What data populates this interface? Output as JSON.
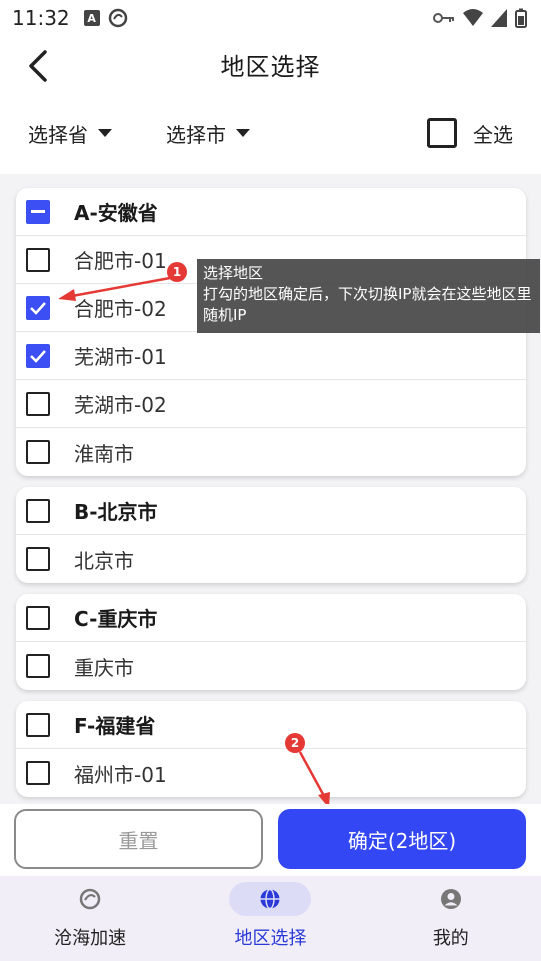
{
  "status": {
    "time": "11:32"
  },
  "header": {
    "title": "地区选择"
  },
  "filters": {
    "province_label": "选择省",
    "city_label": "选择市",
    "select_all_label": "全选"
  },
  "groups": [
    {
      "title": "A-安徽省",
      "state": "partial",
      "items": [
        {
          "label": "合肥市-01",
          "checked": false
        },
        {
          "label": "合肥市-02",
          "checked": true
        },
        {
          "label": "芜湖市-01",
          "checked": true
        },
        {
          "label": "芜湖市-02",
          "checked": false
        },
        {
          "label": "淮南市",
          "checked": false
        }
      ]
    },
    {
      "title": "B-北京市",
      "state": "unchecked",
      "items": [
        {
          "label": "北京市",
          "checked": false
        }
      ]
    },
    {
      "title": "C-重庆市",
      "state": "unchecked",
      "items": [
        {
          "label": "重庆市",
          "checked": false
        }
      ]
    },
    {
      "title": "F-福建省",
      "state": "unchecked",
      "items": [
        {
          "label": "福州市-01",
          "checked": false
        }
      ]
    }
  ],
  "tooltip": {
    "line1": "选择地区",
    "line2": "打勾的地区确定后，下次切换IP就会在这些地区里随机IP"
  },
  "badges": {
    "one": "1",
    "two": "2"
  },
  "buttons": {
    "reset": "重置",
    "confirm": "确定(2地区)"
  },
  "nav": [
    {
      "label": "沧海加速",
      "icon": "app-logo-icon",
      "active": false
    },
    {
      "label": "地区选择",
      "icon": "globe-icon",
      "active": true
    },
    {
      "label": "我的",
      "icon": "person-icon",
      "active": false
    }
  ],
  "colors": {
    "accent": "#3447f5",
    "badge": "#e53935",
    "nav_bg": "#f1eef8"
  }
}
